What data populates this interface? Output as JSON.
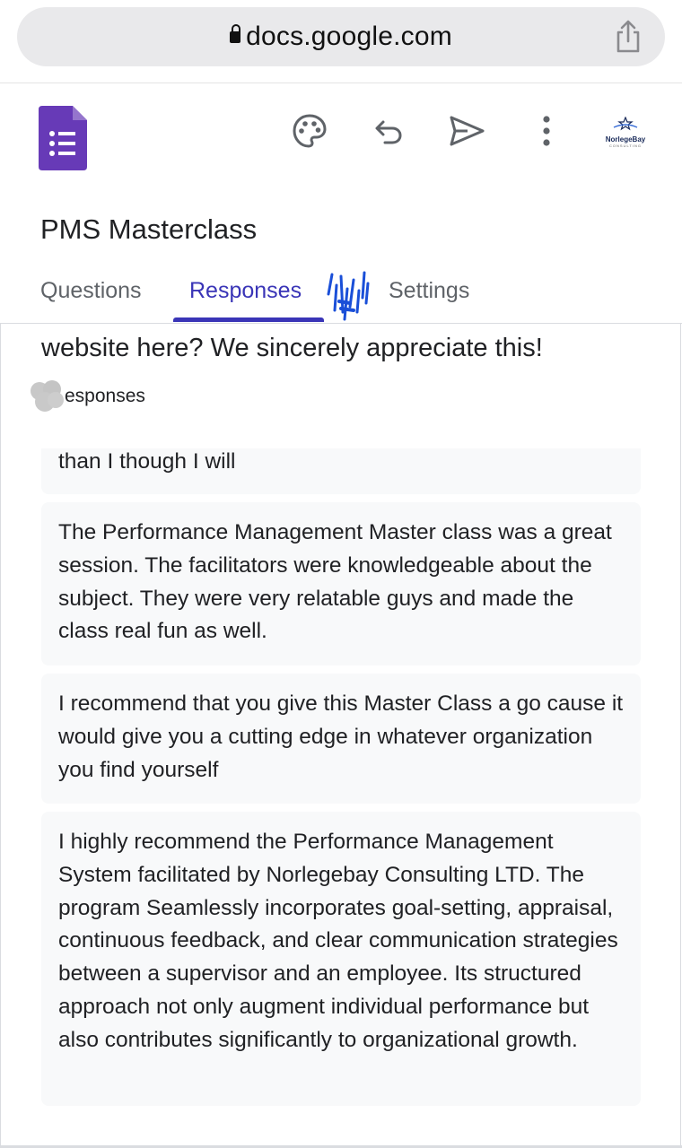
{
  "browser": {
    "url": "docs.google.com"
  },
  "header": {
    "logo_name": "NorlegeBay",
    "logo_sub": "CONSULTING"
  },
  "form": {
    "title": "PMS Masterclass"
  },
  "tabs": [
    {
      "label": "Questions",
      "active": false
    },
    {
      "label": "Responses",
      "active": true
    },
    {
      "label": "Settings",
      "active": false
    }
  ],
  "question": {
    "text": "website here? We sincerely appreciate this!",
    "response_count_label": "esponses"
  },
  "responses": [
    "than I though I will",
    "The Performance Management Master class was a great session. The facilitators were knowledgeable about the subject. They were very relatable guys and made the class real fun as well.",
    "I recommend that you give this Master Class a go cause it would give you a cutting edge in whatever organization you find yourself",
    "I highly recommend the Performance Management System facilitated by Norlegebay Consulting LTD. The program Seamlessly incorporates goal-setting, appraisal, continuous feedback, and clear communication strategies between a supervisor and an employee. Its structured approach not only augment individual performance but also contributes significantly to organizational growth."
  ],
  "colors": {
    "forms_purple": "#673ab7",
    "active_tab": "#3a35b7",
    "response_bg": "#f8f9fa"
  },
  "icons": {
    "lock": "lock-icon",
    "share": "share-icon",
    "palette": "palette-icon",
    "undo": "undo-icon",
    "send": "send-icon",
    "more": "more-vert-icon"
  }
}
